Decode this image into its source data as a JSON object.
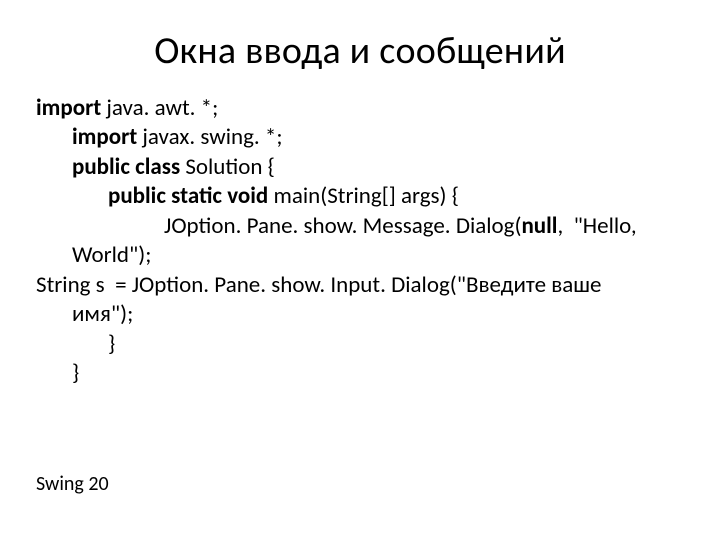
{
  "title": "Окна ввода и сообщений",
  "code": {
    "l1a": "import",
    "l1b": " java. awt. *;",
    "l2a": "import",
    "l2b": " javax. swing. *;",
    "l3a": "public class ",
    "l3b": "Solution {",
    "l4a": "public static void ",
    "l4b": "main(String[] args) {",
    "l5a": "JOption. Pane. show. Message. Dialog(",
    "l5b": "null",
    "l5c": ",  \"Hello,",
    "l6": "World\");",
    "l7": "String s  = JOption. Pane. show. Input. Dialog(\"Введите ваше",
    "l8": "имя\");",
    "l9": "}",
    "l10": "}"
  },
  "footer": "Swing 20"
}
